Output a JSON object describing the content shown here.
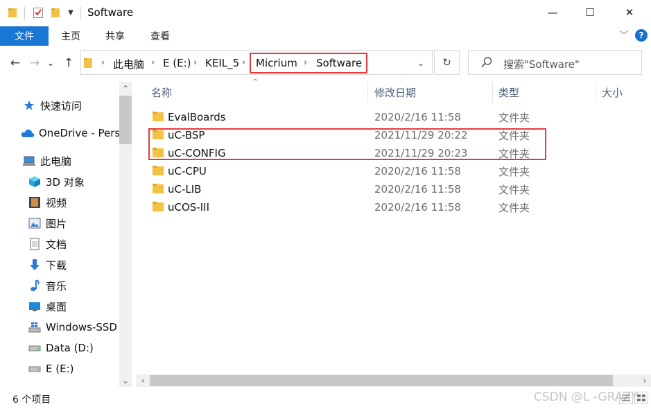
{
  "window": {
    "title": "Software",
    "minimize": "—",
    "maximize": "☐",
    "close": "✕"
  },
  "ribbon": {
    "tabs": [
      "文件",
      "主页",
      "共享",
      "查看"
    ],
    "collapse_icon": "﹀",
    "help": "?"
  },
  "nav": {
    "back": "←",
    "forward": "→",
    "recent": "⌄",
    "up": "↑",
    "refresh": "↻",
    "dropdown": "⌄"
  },
  "address": {
    "crumbs": [
      "此电脑",
      "E (E:)",
      "KEIL_5",
      "Micrium",
      "Software"
    ],
    "separator": "›"
  },
  "search": {
    "placeholder": "搜索\"Software\""
  },
  "navpane": {
    "items": [
      {
        "label": "快速访问",
        "icon": "star-icon"
      },
      {
        "label": "OneDrive - Pers",
        "icon": "cloud-icon"
      },
      {
        "label": "此电脑",
        "icon": "computer-icon"
      },
      {
        "label": "3D 对象",
        "icon": "cube-icon"
      },
      {
        "label": "视频",
        "icon": "film-icon"
      },
      {
        "label": "图片",
        "icon": "picture-icon"
      },
      {
        "label": "文档",
        "icon": "document-icon"
      },
      {
        "label": "下载",
        "icon": "download-icon"
      },
      {
        "label": "音乐",
        "icon": "music-icon"
      },
      {
        "label": "桌面",
        "icon": "desktop-icon"
      },
      {
        "label": "Windows-SSD",
        "icon": "drive-icon"
      },
      {
        "label": "Data (D:)",
        "icon": "drive-icon"
      },
      {
        "label": "E (E:)",
        "icon": "drive-icon"
      }
    ],
    "scroll_up": "⌃",
    "scroll_down": "⌄"
  },
  "columns": {
    "name": "名称",
    "modified": "修改日期",
    "type": "类型",
    "size": "大小",
    "sort_indicator": "^"
  },
  "files": [
    {
      "name": "EvalBoards",
      "modified": "2020/2/16 11:58",
      "type": "文件夹"
    },
    {
      "name": "uC-BSP",
      "modified": "2021/11/29 20:22",
      "type": "文件夹"
    },
    {
      "name": "uC-CONFIG",
      "modified": "2021/11/29 20:23",
      "type": "文件夹"
    },
    {
      "name": "uC-CPU",
      "modified": "2020/2/16 11:58",
      "type": "文件夹"
    },
    {
      "name": "uC-LIB",
      "modified": "2020/2/16 11:58",
      "type": "文件夹"
    },
    {
      "name": "uCOS-III",
      "modified": "2020/2/16 11:58",
      "type": "文件夹"
    }
  ],
  "hscroll": {
    "left": "‹",
    "right": "›"
  },
  "status": {
    "count": "6 个项目"
  },
  "watermark": "CSDN @L -GRAZY",
  "colors": {
    "accent": "#1976d2",
    "highlight_box": "#e8383d",
    "folder": "#f3c244"
  }
}
